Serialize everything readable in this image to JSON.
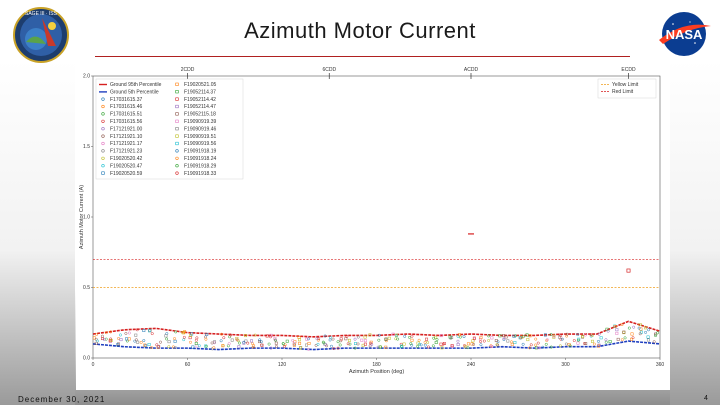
{
  "slide": {
    "title": "Azimuth Motor Current",
    "footer_date": "December 30, 2021",
    "page_number": "4",
    "accent_color": "#b02020",
    "logos": {
      "left": {
        "icon": "sage-iii-iss-mission-patch",
        "text": "SAGE III · ISS"
      },
      "right": {
        "icon": "nasa-meatball-logo",
        "text": "NASA"
      }
    }
  },
  "chart_data": {
    "type": "scatter",
    "title": "",
    "xlabel": "Azimuth Position (deg)",
    "ylabel": "Azimuth Motor Current (A)",
    "xlim": [
      0,
      360
    ],
    "ylim": [
      0,
      2.0
    ],
    "x_ticks": [
      "0",
      "60",
      "120",
      "180",
      "240",
      "300",
      "360"
    ],
    "y_ticks": [
      "0.0",
      "0.5",
      "1.0",
      "1.5",
      "2.0"
    ],
    "top_markers": [
      {
        "label": "2CDD",
        "x": 60
      },
      {
        "label": "6CDD",
        "x": 150
      },
      {
        "label": "ACDD",
        "x": 240
      },
      {
        "label": "ECDD",
        "x": 340
      }
    ],
    "limit_lines": [
      {
        "name": "Yellow Limit",
        "value": 0.5,
        "color": "#f0a020"
      },
      {
        "name": "Red Limit",
        "value": 0.7,
        "color": "#d62020"
      }
    ],
    "legend_col1": [
      {
        "name": "Ground 95th Percentile",
        "marker": "line",
        "color": "#d62020"
      },
      {
        "name": "Ground 5th Percentile",
        "marker": "line",
        "color": "#1f3fbf"
      },
      {
        "name": "F17031615.37",
        "marker": "circle",
        "color": "#1f77b4"
      },
      {
        "name": "F17031615.46",
        "marker": "circle",
        "color": "#ff7f0e"
      },
      {
        "name": "F17031615.51",
        "marker": "circle",
        "color": "#2ca02c"
      },
      {
        "name": "F17031615.56",
        "marker": "circle",
        "color": "#d62728"
      },
      {
        "name": "F17121921.00",
        "marker": "circle",
        "color": "#9467bd"
      },
      {
        "name": "F17121921.10",
        "marker": "circle",
        "color": "#8c564b"
      },
      {
        "name": "F17121921.17",
        "marker": "circle",
        "color": "#e377c2"
      },
      {
        "name": "F17121921.23",
        "marker": "circle",
        "color": "#7f7f7f"
      },
      {
        "name": "F19020520.42",
        "marker": "circle",
        "color": "#bcbd22"
      },
      {
        "name": "F19020520.47",
        "marker": "circle",
        "color": "#17becf"
      },
      {
        "name": "F19020520.59",
        "marker": "square",
        "color": "#1f77b4"
      }
    ],
    "legend_col2": [
      {
        "name": "F19020521.05",
        "marker": "square",
        "color": "#ff7f0e"
      },
      {
        "name": "F19052114.37",
        "marker": "square",
        "color": "#2ca02c"
      },
      {
        "name": "F19052114.42",
        "marker": "square",
        "color": "#d62728"
      },
      {
        "name": "F19052114.47",
        "marker": "square",
        "color": "#9467bd"
      },
      {
        "name": "F19052115.18",
        "marker": "square",
        "color": "#8c564b"
      },
      {
        "name": "F19090919.39",
        "marker": "square",
        "color": "#e377c2"
      },
      {
        "name": "F19090919.46",
        "marker": "square",
        "color": "#7f7f7f"
      },
      {
        "name": "F19090919.51",
        "marker": "square",
        "color": "#bcbd22"
      },
      {
        "name": "F19090919.56",
        "marker": "square",
        "color": "#17becf"
      },
      {
        "name": "F19091918.19",
        "marker": "circle",
        "color": "#1f77b4"
      },
      {
        "name": "F19091918.24",
        "marker": "circle",
        "color": "#ff7f0e"
      },
      {
        "name": "F19091918.29",
        "marker": "circle",
        "color": "#2ca02c"
      },
      {
        "name": "F19091918.33",
        "marker": "circle",
        "color": "#d62728"
      }
    ],
    "legend_limits": [
      {
        "name": "Yellow Limit",
        "color": "#f0a020"
      },
      {
        "name": "Red Limit",
        "color": "#d62020"
      }
    ],
    "ground_95th": {
      "x": [
        0,
        20,
        40,
        60,
        80,
        100,
        120,
        140,
        160,
        180,
        200,
        220,
        240,
        260,
        280,
        300,
        320,
        340,
        360
      ],
      "y": [
        0.17,
        0.2,
        0.21,
        0.18,
        0.17,
        0.16,
        0.16,
        0.15,
        0.16,
        0.16,
        0.17,
        0.16,
        0.17,
        0.16,
        0.16,
        0.17,
        0.17,
        0.26,
        0.19
      ]
    },
    "ground_5th": {
      "x": [
        0,
        20,
        40,
        60,
        80,
        100,
        120,
        140,
        160,
        180,
        200,
        220,
        240,
        260,
        280,
        300,
        320,
        340,
        360
      ],
      "y": [
        0.1,
        0.08,
        0.07,
        0.07,
        0.06,
        0.07,
        0.07,
        0.06,
        0.07,
        0.07,
        0.07,
        0.07,
        0.07,
        0.08,
        0.07,
        0.08,
        0.08,
        0.12,
        0.1
      ]
    },
    "outliers": [
      {
        "x": 240,
        "y": 0.88,
        "color": "#d62020",
        "marker": "dash"
      },
      {
        "x": 340,
        "y": 0.62,
        "color": "#d62728",
        "marker": "square"
      }
    ]
  }
}
